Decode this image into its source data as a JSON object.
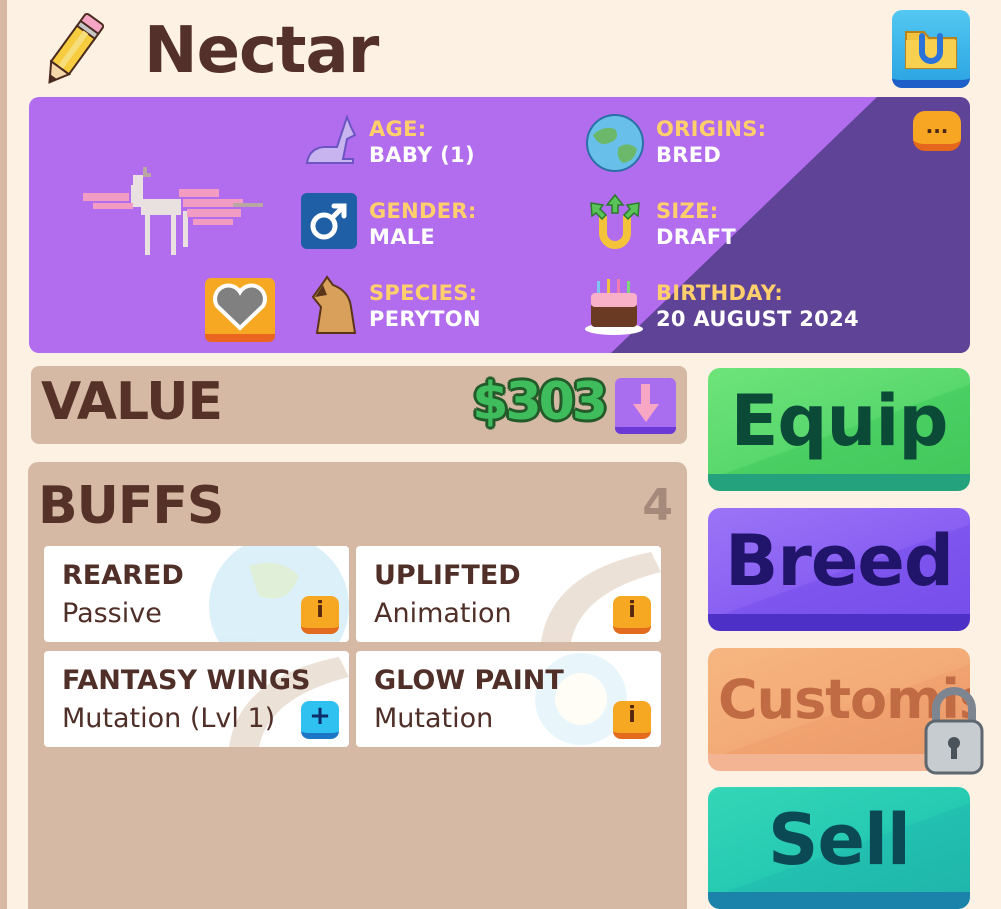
{
  "pet": {
    "name": "Nectar"
  },
  "stats": {
    "age": {
      "label": "AGE:",
      "value": "BABY (1)",
      "icon": "horse-lying-icon"
    },
    "gender": {
      "label": "GENDER:",
      "value": "MALE",
      "icon": "male-symbol-icon"
    },
    "species": {
      "label": "SPECIES:",
      "value": "PERYTON",
      "icon": "horse-head-icon"
    },
    "origins": {
      "label": "ORIGINS:",
      "value": "BRED",
      "icon": "globe-icon"
    },
    "size": {
      "label": "SIZE:",
      "value": "DRAFT",
      "icon": "horseshoe-arrows-icon"
    },
    "birthday": {
      "label": "BIRTHDAY:",
      "value": "20 AUGUST 2024",
      "icon": "birthday-cake-icon"
    }
  },
  "more_button": {
    "label": "..."
  },
  "value": {
    "label": "VALUE",
    "amount": "$303",
    "trend_icon": "down-arrow-icon"
  },
  "buffs": {
    "title": "BUFFS",
    "count": "4",
    "items": [
      {
        "name": "REARED",
        "type": "Passive",
        "button": "i"
      },
      {
        "name": "UPLIFTED",
        "type": "Animation",
        "button": "i"
      },
      {
        "name": "FANTASY WINGS",
        "type": "Mutation (Lvl 1)",
        "button": "+"
      },
      {
        "name": "GLOW PAINT",
        "type": "Mutation",
        "button": "i"
      }
    ]
  },
  "actions": {
    "equip": "Equip",
    "breed": "Breed",
    "customise": "Customise",
    "sell": "Sell"
  },
  "colors": {
    "background": "#fdf1e3",
    "panel_purple": "#b26cee",
    "panel_purple_dark": "#5f4396",
    "label_gold": "#ffcf6b",
    "equip_green": "#59d86d",
    "breed_purple": "#8960f2",
    "customise_orange": "#f3aa76",
    "sell_teal": "#26cab2"
  }
}
